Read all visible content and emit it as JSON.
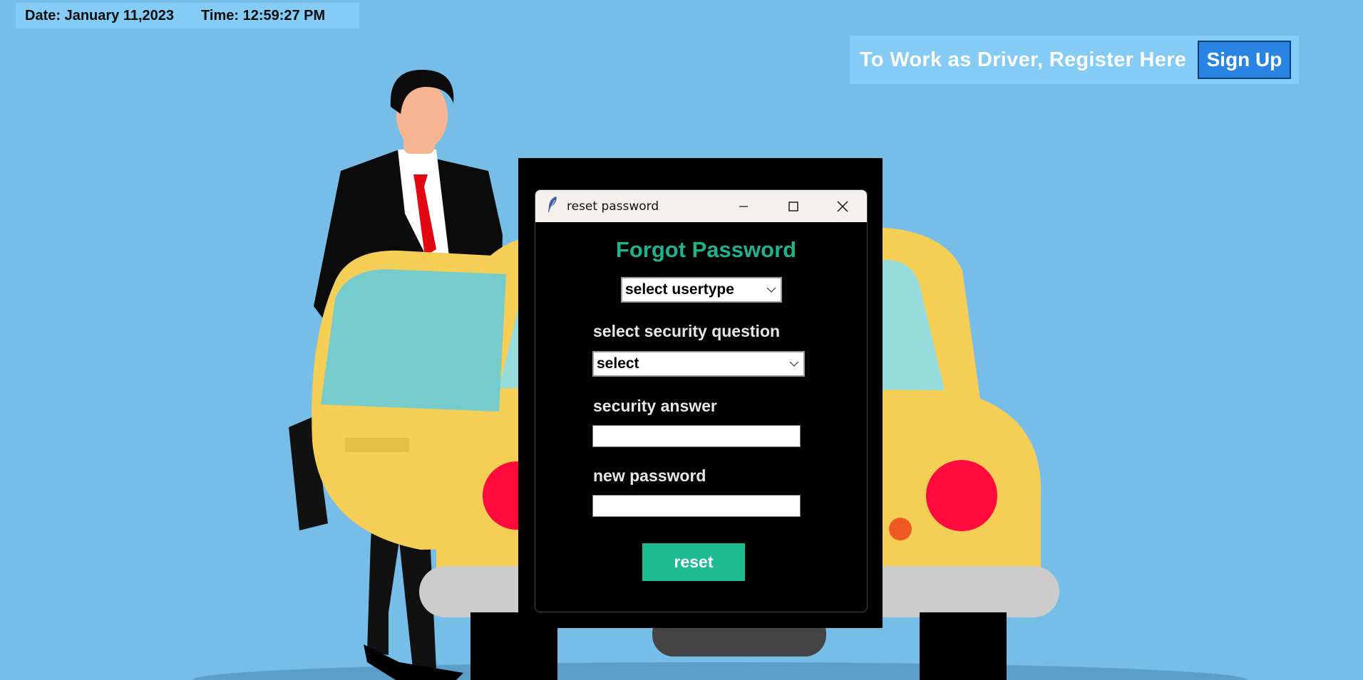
{
  "header": {
    "date_label": "Date: January 11,2023",
    "time_label": "Time: 12:59:27 PM"
  },
  "register": {
    "text": "To Work as Driver, Register Here",
    "signup_label": "Sign Up"
  },
  "dialog": {
    "title": "reset password",
    "heading": "Forgot Password",
    "usertype_select": {
      "value": "select usertype"
    },
    "security_question_label": "select security question",
    "security_question_select": {
      "value": "select"
    },
    "security_answer_label": "security answer",
    "security_answer_value": "",
    "new_password_label": "new password",
    "new_password_value": "",
    "reset_label": "reset"
  },
  "icons": {
    "app": "feather-icon",
    "minimize": "minimize-icon",
    "maximize": "maximize-icon",
    "close": "close-icon",
    "dropdown": "chevron-down-icon"
  },
  "colors": {
    "background": "#76bde8",
    "info_bar": "#84ccf5",
    "accent_green": "#1eb38b",
    "signup_blue": "#2a84e4",
    "taxi_yellow": "#f5cf55",
    "taillight_red": "#ff0a3c"
  }
}
